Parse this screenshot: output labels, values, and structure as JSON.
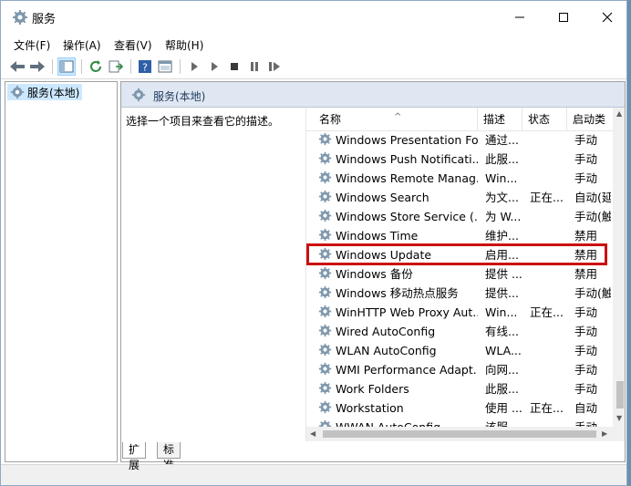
{
  "window": {
    "title": "服务"
  },
  "menu": [
    "文件(F)",
    "操作(A)",
    "查看(V)",
    "帮助(H)"
  ],
  "tree": {
    "item": "服务(本地)"
  },
  "pane": {
    "header": "服务(本地)",
    "description": "选择一个项目来查看它的描述。"
  },
  "columns": {
    "name": "名称",
    "desc": "描述",
    "status": "状态",
    "startup": "启动类"
  },
  "services": [
    {
      "name": "Windows Presentation Fo...",
      "desc": "通过...",
      "status": "",
      "startup": "手动"
    },
    {
      "name": "Windows Push Notificati...",
      "desc": "此服...",
      "status": "",
      "startup": "手动"
    },
    {
      "name": "Windows Remote Manag...",
      "desc": "Win...",
      "status": "",
      "startup": "手动"
    },
    {
      "name": "Windows Search",
      "desc": "为文...",
      "status": "正在...",
      "startup": "自动(延"
    },
    {
      "name": "Windows Store Service (...",
      "desc": "为 W...",
      "status": "",
      "startup": "手动(触"
    },
    {
      "name": "Windows Time",
      "desc": "维护...",
      "status": "",
      "startup": "禁用"
    },
    {
      "name": "Windows Update",
      "desc": "启用...",
      "status": "",
      "startup": "禁用"
    },
    {
      "name": "Windows 备份",
      "desc": "提供 ...",
      "status": "",
      "startup": "禁用"
    },
    {
      "name": "Windows 移动热点服务",
      "desc": "提供...",
      "status": "",
      "startup": "手动(触"
    },
    {
      "name": "WinHTTP Web Proxy Aut...",
      "desc": "Win...",
      "status": "正在...",
      "startup": "手动"
    },
    {
      "name": "Wired AutoConfig",
      "desc": "有线...",
      "status": "",
      "startup": "手动"
    },
    {
      "name": "WLAN AutoConfig",
      "desc": "WLA...",
      "status": "",
      "startup": "手动"
    },
    {
      "name": "WMI Performance Adapt...",
      "desc": "向网...",
      "status": "",
      "startup": "手动"
    },
    {
      "name": "Work Folders",
      "desc": "此服...",
      "status": "",
      "startup": "手动"
    },
    {
      "name": "Workstation",
      "desc": "使用 ...",
      "status": "正在...",
      "startup": "自动"
    },
    {
      "name": "WWAN AutoConfig",
      "desc": "该服...",
      "status": "",
      "startup": "手动"
    }
  ],
  "tabs": [
    "扩展",
    "标准"
  ],
  "colors": {
    "highlight": "#cc1010",
    "selection": "#cce8ff",
    "pane_header": "#dfe7f2"
  }
}
